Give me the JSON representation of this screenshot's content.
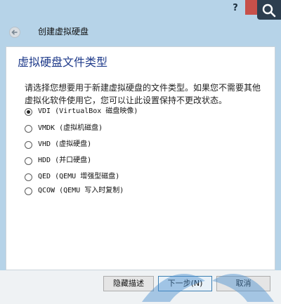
{
  "titlebar": {
    "help_label": "?",
    "close_label": "✕"
  },
  "header": {
    "title": "创建虚拟硬盘"
  },
  "panel": {
    "title": "虚拟硬盘文件类型",
    "description": "请选择您想要用于新建虚拟硬盘的文件类型。如果您不需要其他虚拟化软件使用它，您可以让此设置保持不更改状态。"
  },
  "options": [
    {
      "label": "VDI (VirtualBox 磁盘映像)",
      "selected": true
    },
    {
      "label": "VMDK (虚拟机磁盘)",
      "selected": false
    },
    {
      "label": "VHD (虚拟硬盘)",
      "selected": false
    },
    {
      "label": "HDD (并口硬盘)",
      "selected": false
    },
    {
      "label": "QED (QEMU 增强型磁盘)",
      "selected": false
    },
    {
      "label": "QCOW (QEMU 写入时复制)",
      "selected": false
    }
  ],
  "footer": {
    "hide_desc_label": "隐藏描述",
    "next_label": "下一步(N)",
    "cancel_label": "取消"
  },
  "icons": {
    "back": "back-arrow-icon",
    "search": "search-icon",
    "close": "close-icon"
  },
  "colors": {
    "frame": "#b6d3e8",
    "close_button": "#c7504a",
    "title_text": "#1e3a8a"
  }
}
